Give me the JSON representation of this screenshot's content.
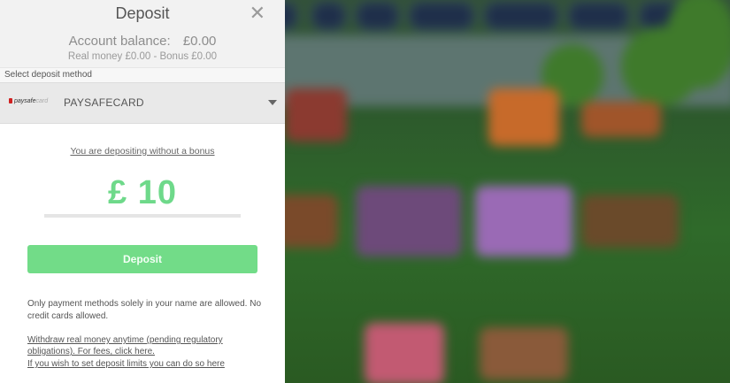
{
  "modal": {
    "title": "Deposit",
    "close_icon": "close-icon",
    "balance_label": "Account balance:",
    "balance_value": "£0.00",
    "money_line": "Real money  £0.00 - Bonus  £0.00",
    "select_label": "Select deposit method",
    "method": {
      "logo_text_red": "paysafe",
      "logo_text_card": "card",
      "name": "PAYSAFECARD",
      "caret_icon": "chevron-down-icon"
    },
    "bonus_text": "You are depositing without a bonus",
    "amount": "£ 10",
    "deposit_button": "Deposit",
    "note": "Only payment methods solely in your name are allowed. No credit cards allowed.",
    "withdraw_link": "Withdraw real money anytime (pending regulatory obligations). For fees, click here.",
    "limits_link": "If you wish to set deposit limits you can do so here"
  },
  "colors": {
    "accent_green": "#72dc88",
    "amount_green": "#6ed98a"
  }
}
